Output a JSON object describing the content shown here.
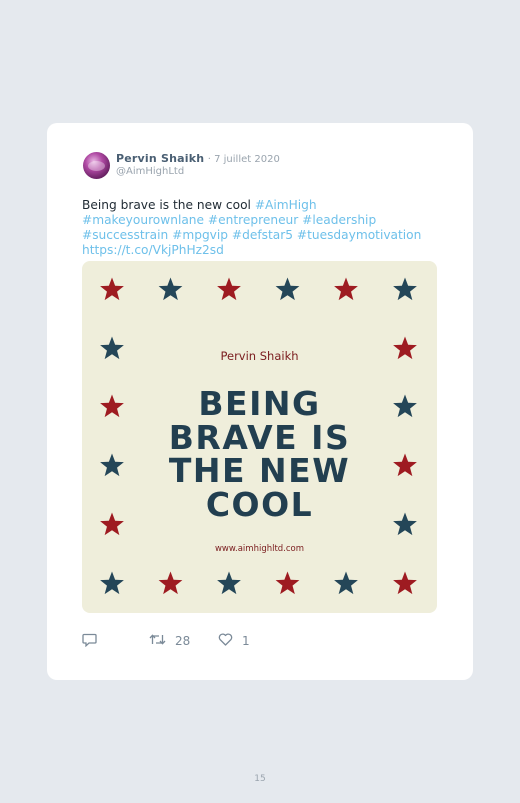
{
  "tweet": {
    "author_name": "Pervin Shaikh",
    "date": "· 7 juillet 2020",
    "handle": "@AimHighLtd",
    "text_plain": "Being brave is the new cool ",
    "text_tags": "#AimHigh #makeyourownlane #entrepreneur #leadership #successtrain #mpgvip #defstar5 #tuesdaymotivation https://t.co/VkjPhHz2sd"
  },
  "image": {
    "author": "Pervin Shaikh",
    "headline_lines": [
      "BEING",
      "BRAVE IS",
      "THE NEW",
      "COOL"
    ],
    "url": "www.aimhighltd.com",
    "colors": {
      "background": "#efeedb",
      "red_star": "#9e1b21",
      "blue_star": "#244658",
      "headline": "#223f50"
    },
    "top_row_stars": [
      "red",
      "blue",
      "red",
      "blue",
      "red",
      "blue"
    ],
    "bottom_row_stars": [
      "blue",
      "red",
      "blue",
      "red",
      "blue",
      "red"
    ],
    "left_column_stars": [
      "blue",
      "red",
      "blue",
      "red"
    ],
    "right_column_stars": [
      "red",
      "blue",
      "red",
      "blue"
    ]
  },
  "actions": {
    "reply_icon": "reply-icon",
    "retweet_icon": "retweet-icon",
    "retweet_count": "28",
    "like_icon": "heart-icon",
    "like_count": "1"
  },
  "page_number": "15"
}
